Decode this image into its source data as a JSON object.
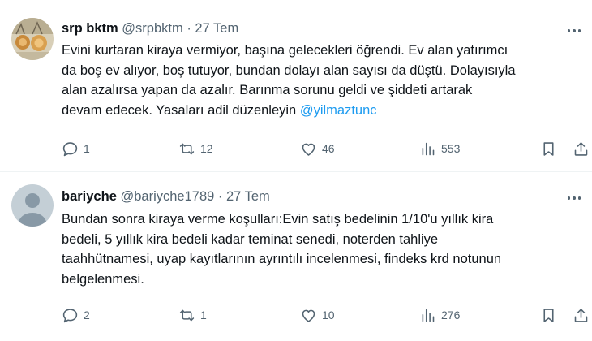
{
  "tweets": [
    {
      "name": "srp bktm",
      "handle": "@srpbktm",
      "separator": "·",
      "date": "27 Tem",
      "text_lines": [
        "Evini kurtaran kiraya vermiyor, başına gelecekleri öğrendi. Ev alan yatırımcı",
        "da boş ev alıyor, boş tutuyor, bundan dolayı alan sayısı da düştü. Dolayısıyla",
        "alan azalırsa yapan da azalır. Barınma sorunu geldi  ve şiddeti artarak",
        "devam edecek. Yasaları adil düzenleyin "
      ],
      "mention": "@yilmaztunc",
      "replies": "1",
      "retweets": "12",
      "likes": "46",
      "views": "553"
    },
    {
      "name": "bariyche",
      "handle": "@bariyche1789",
      "separator": "·",
      "date": "27 Tem",
      "text_lines": [
        "Bundan sonra kiraya verme koşulları:Evin satış bedelinin 1/10'u yıllık kira",
        "bedeli, 5 yıllık kira bedeli kadar teminat senedi, noterden tahliye",
        "taahhütnamesi, uyap kayıtlarının ayrıntılı incelenmesi, findeks krd notunun",
        "belgelenmesi."
      ],
      "replies": "2",
      "retweets": "1",
      "likes": "10",
      "views": "276"
    }
  ],
  "colors": {
    "text": "#0f1419",
    "secondary": "#536471",
    "link": "#1d9bf0",
    "divider": "#eff3f4"
  },
  "icons": [
    "more-icon",
    "reply-icon",
    "retweet-icon",
    "like-icon",
    "views-icon",
    "bookmark-icon",
    "share-icon"
  ]
}
